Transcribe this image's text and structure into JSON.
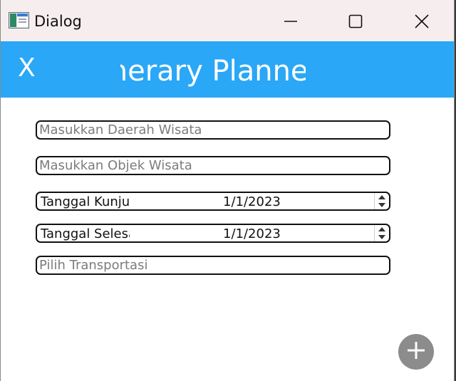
{
  "window": {
    "title": "Dialog",
    "controls": [
      "minimize-icon",
      "maximize-icon",
      "close-icon"
    ]
  },
  "header": {
    "close_label": "X",
    "title": "tinerary Planner"
  },
  "form": {
    "daerah_placeholder": "Masukkan Daerah Wisata",
    "objek_placeholder": "Masukkan Objek Wisata",
    "tanggal_kunjungan": {
      "label": "Tanggal Kunjungan",
      "value": "1/1/2023"
    },
    "tanggal_selesai": {
      "label": "Tanggal Selesai",
      "value": "1/1/2023"
    },
    "transportasi_placeholder": "Pilih Transportasi"
  },
  "fab": {
    "icon": "plus-icon"
  },
  "colors": {
    "header_bg": "#2aa7f6",
    "titlebar_bg": "#f6eeee",
    "fab_bg": "#8c8c8c"
  }
}
